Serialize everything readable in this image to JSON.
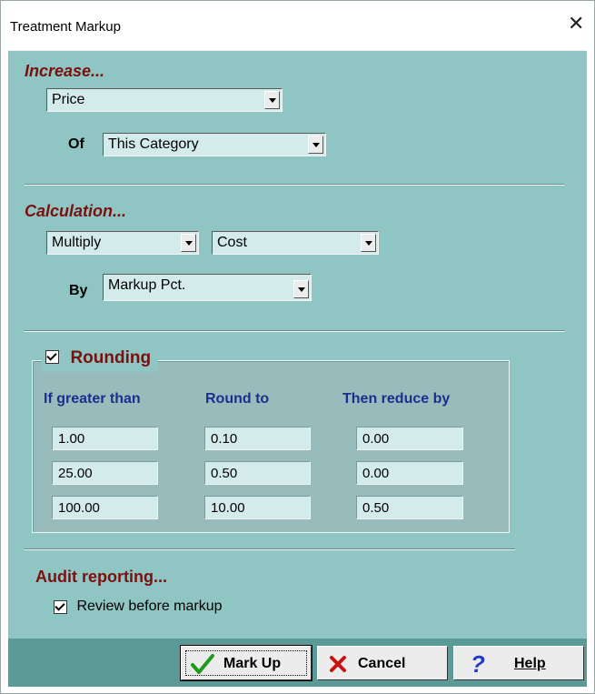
{
  "window": {
    "title": "Treatment Markup"
  },
  "increase": {
    "heading": "Increase...",
    "field_value": "Price",
    "of_label": "Of",
    "of_value": "This Category"
  },
  "calculation": {
    "heading": "Calculation...",
    "operation": "Multiply",
    "operand": "Cost",
    "by_label": "By",
    "by_value": "Markup Pct."
  },
  "rounding": {
    "label": "Rounding",
    "checked": true,
    "headers": [
      "If greater than",
      "Round to",
      "Then reduce by"
    ],
    "rows": [
      [
        "1.00",
        "0.10",
        "0.00"
      ],
      [
        "25.00",
        "0.50",
        "0.00"
      ],
      [
        "100.00",
        "10.00",
        "0.50"
      ]
    ]
  },
  "audit": {
    "heading": "Audit reporting...",
    "review_label": "Review before markup",
    "review_checked": true
  },
  "buttons": {
    "markup": "Mark Up",
    "cancel": "Cancel",
    "help": "Help"
  },
  "icons": {
    "close": "close-icon",
    "markup": "checkmark-icon",
    "cancel": "x-icon",
    "help": "question-icon"
  }
}
